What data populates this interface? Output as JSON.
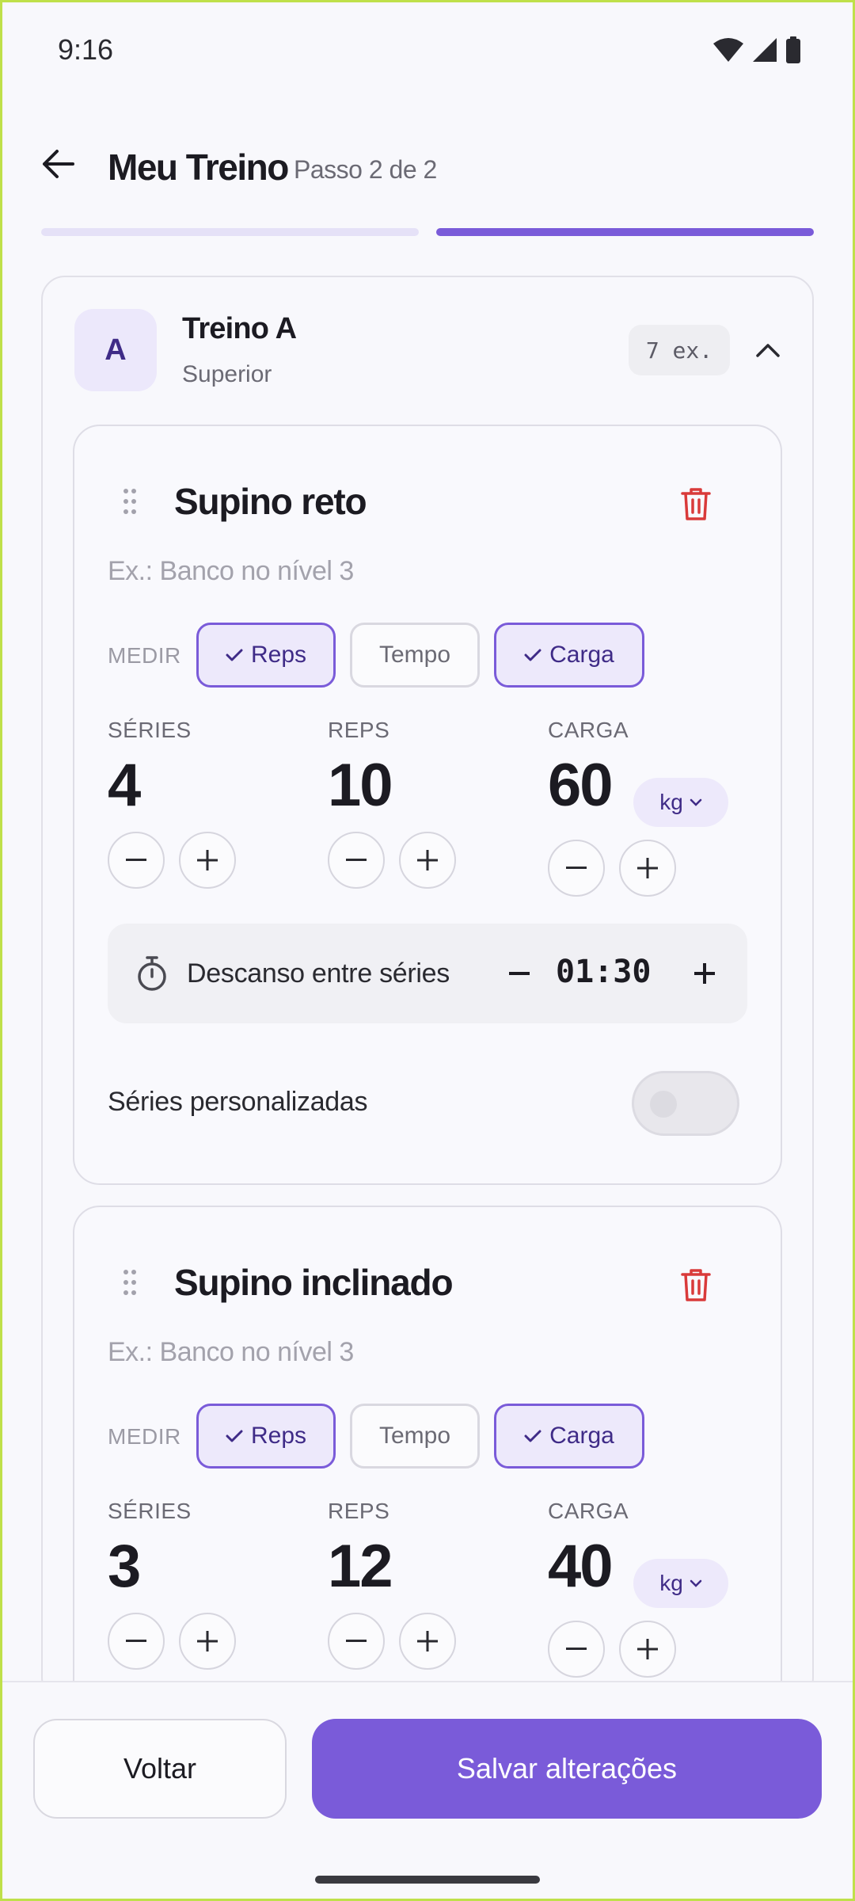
{
  "status_bar": {
    "time": "9:16"
  },
  "header": {
    "title": "Meu Treino",
    "step": "Passo 2 de 2"
  },
  "progress": {
    "total_steps": 2,
    "current_step": 2
  },
  "workout": {
    "avatar_letter": "A",
    "name": "Treino A",
    "subtitle": "Superior",
    "exercise_count": "7 ex."
  },
  "measure_label": "MEDIR",
  "labels": {
    "series": "SÉRIES",
    "reps": "REPS",
    "carga": "CARGA"
  },
  "exercises": [
    {
      "name": "Supino reto",
      "note_placeholder": "Ex.: Banco no nível 3",
      "chips": [
        {
          "label": "Reps",
          "selected": true
        },
        {
          "label": "Tempo",
          "selected": false
        },
        {
          "label": "Carga",
          "selected": true
        }
      ],
      "series": "4",
      "reps": "10",
      "carga": "60",
      "unit": "kg",
      "rest_label": "Descanso entre séries",
      "rest_time": "01:30",
      "custom_series_label": "Séries personalizadas",
      "custom_series_enabled": false
    },
    {
      "name": "Supino inclinado",
      "note_placeholder": "Ex.: Banco no nível 3",
      "chips": [
        {
          "label": "Reps",
          "selected": true
        },
        {
          "label": "Tempo",
          "selected": false
        },
        {
          "label": "Carga",
          "selected": true
        }
      ],
      "series": "3",
      "reps": "12",
      "carga": "40",
      "unit": "kg"
    }
  ],
  "footer": {
    "back_label": "Voltar",
    "save_label": "Salvar alterações"
  },
  "colors": {
    "accent": "#7a5bd9",
    "accent_light": "#ede9fb",
    "danger": "#d93a3a",
    "text": "#1c1b22",
    "muted": "#6b6a74"
  }
}
